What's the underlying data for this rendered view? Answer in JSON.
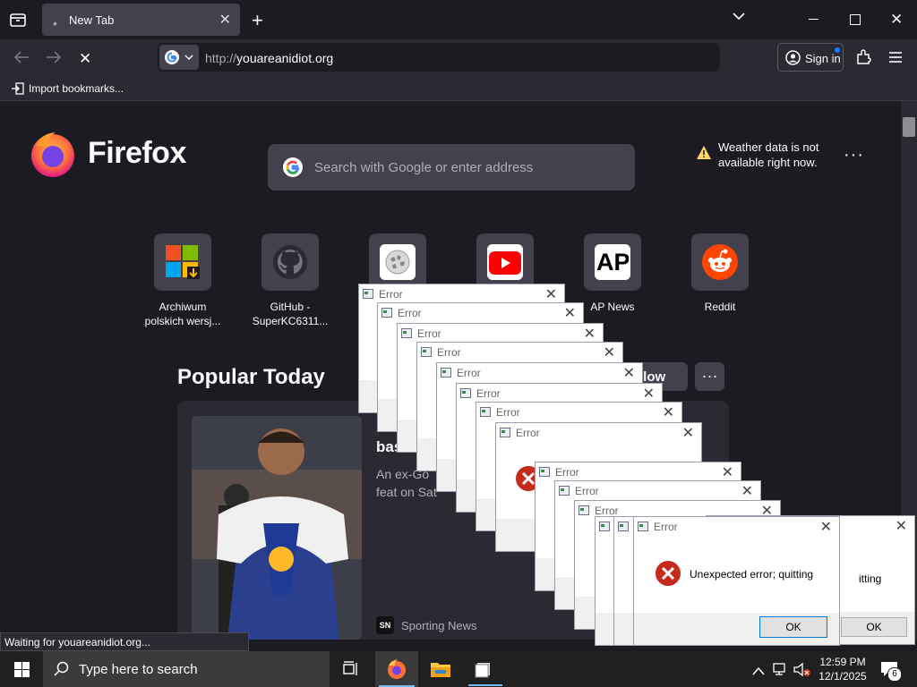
{
  "browser": {
    "tab_title": "New Tab",
    "url_prefix": "http://",
    "url_host": "youareanidiot.org",
    "sign_in_label": "Sign in",
    "import_bookmarks": "Import bookmarks...",
    "status_text": "Waiting for youareanidiot.org..."
  },
  "newtab": {
    "brand": "Firefox",
    "search_placeholder": "Search with Google or enter address",
    "weather_line1": "Weather data is not",
    "weather_line2": "available right now.",
    "top_sites": [
      {
        "label_line1": "Archiwum",
        "label_line2": "polskich wersj...",
        "icon": "windows-download-icon"
      },
      {
        "label_line1": "GitHub -",
        "label_line2": "SuperKC6311...",
        "icon": "github-icon"
      },
      {
        "label_line1": "",
        "label_line2": "",
        "icon": "wikipedia-icon"
      },
      {
        "label_line1": "",
        "label_line2": "",
        "icon": "youtube-icon"
      },
      {
        "label_line1": "AP News",
        "label_line2": "",
        "icon": "ap-news-icon"
      },
      {
        "label_line1": "Reddit",
        "label_line2": "",
        "icon": "reddit-icon"
      }
    ],
    "popular_heading": "Popular Today",
    "follow_label": "llow",
    "story": {
      "title_fragment": "bas",
      "desc_line1": "An ex-Go",
      "desc_line2": "feat on Sat",
      "source": "Sporting News",
      "source_badge": "SN"
    }
  },
  "dialogs": {
    "title": "Error",
    "message": "Unexpected error; quitting",
    "message_fragment": "itting",
    "ok_label": "OK"
  },
  "taskbar": {
    "search_placeholder": "Type here to search",
    "time": "12:59 PM",
    "date": "12/1/2025",
    "notification_count": "6"
  },
  "colors": {
    "firefox_orange": "#ff7139",
    "error_red": "#c42b1c",
    "accent_blue": "#0a84ff"
  }
}
